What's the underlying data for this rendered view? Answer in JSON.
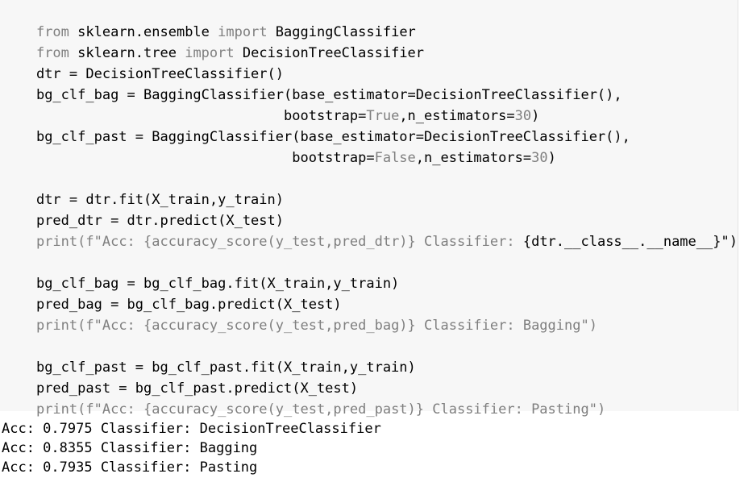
{
  "code_lines": [
    [
      "",
      "from",
      " sklearn.ensemble ",
      "import",
      " BaggingClassifier"
    ],
    [
      "",
      "from",
      " sklearn.tree ",
      "import",
      " DecisionTreeClassifier"
    ],
    [
      "dtr = DecisionTreeClassifier()"
    ],
    [
      "bg_clf_bag = BaggingClassifier(base_estimator=DecisionTreeClassifier(),"
    ],
    [
      "                              bootstrap=",
      "True",
      ",n_estimators=",
      "30",
      ")"
    ],
    [
      "bg_clf_past = BaggingClassifier(base_estimator=DecisionTreeClassifier(),"
    ],
    [
      "                               bootstrap=",
      "False",
      ",n_estimators=",
      "30",
      ")"
    ],
    [
      ""
    ],
    [
      "dtr = dtr.fit(X_train,y_train)"
    ],
    [
      "pred_dtr = dtr.predict(X_test)"
    ],
    [
      "",
      "print",
      "(f\"Acc: {accuracy_score(y_test,pred_dtr)}",
      " Classifier: ",
      "{dtr.__class__.__name__}\")"
    ],
    [
      ""
    ],
    [
      "bg_clf_bag = bg_clf_bag.fit(X_train,y_train)"
    ],
    [
      "pred_bag = bg_clf_bag.predict(X_test)"
    ],
    [
      "",
      "print",
      "(f\"Acc: {accuracy_score(y_test,pred_bag)}",
      " Classifier: Bagging",
      "\")"
    ],
    [
      ""
    ],
    [
      "bg_clf_past = bg_clf_past.fit(X_train,y_train)"
    ],
    [
      "pred_past = bg_clf_past.predict(X_test)"
    ],
    [
      "",
      "print",
      "(f\"Acc: {accuracy_score(y_test,pred_past)}",
      " Classifier: Pasting",
      "\")"
    ]
  ],
  "output_lines": [
    "Acc: 0.7975 Classifier: DecisionTreeClassifier",
    "Acc: 0.8355 Classifier: Bagging",
    "Acc: 0.7935 Classifier: Pasting"
  ]
}
